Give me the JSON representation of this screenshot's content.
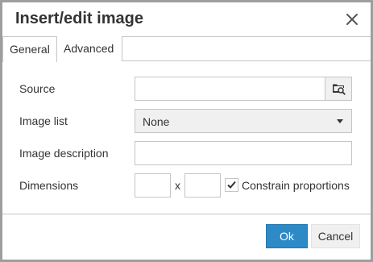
{
  "dialog": {
    "title": "Insert/edit image",
    "close_icon": "close-icon"
  },
  "tabs": [
    {
      "label": "General",
      "active": true
    },
    {
      "label": "Advanced",
      "active": false
    }
  ],
  "form": {
    "source": {
      "label": "Source",
      "value": "",
      "browse_icon": "folder-search-icon"
    },
    "image_list": {
      "label": "Image list",
      "selected": "None"
    },
    "description": {
      "label": "Image description",
      "value": ""
    },
    "dimensions": {
      "label": "Dimensions",
      "width": "",
      "height": "",
      "separator": "x",
      "constrain_label": "Constrain proportions",
      "constrain_checked": true
    }
  },
  "footer": {
    "ok_label": "Ok",
    "cancel_label": "Cancel"
  },
  "colors": {
    "primary": "#2d8ac7",
    "border": "#c5c5c5",
    "text": "#333333",
    "backdrop": "#9e9e9e"
  }
}
